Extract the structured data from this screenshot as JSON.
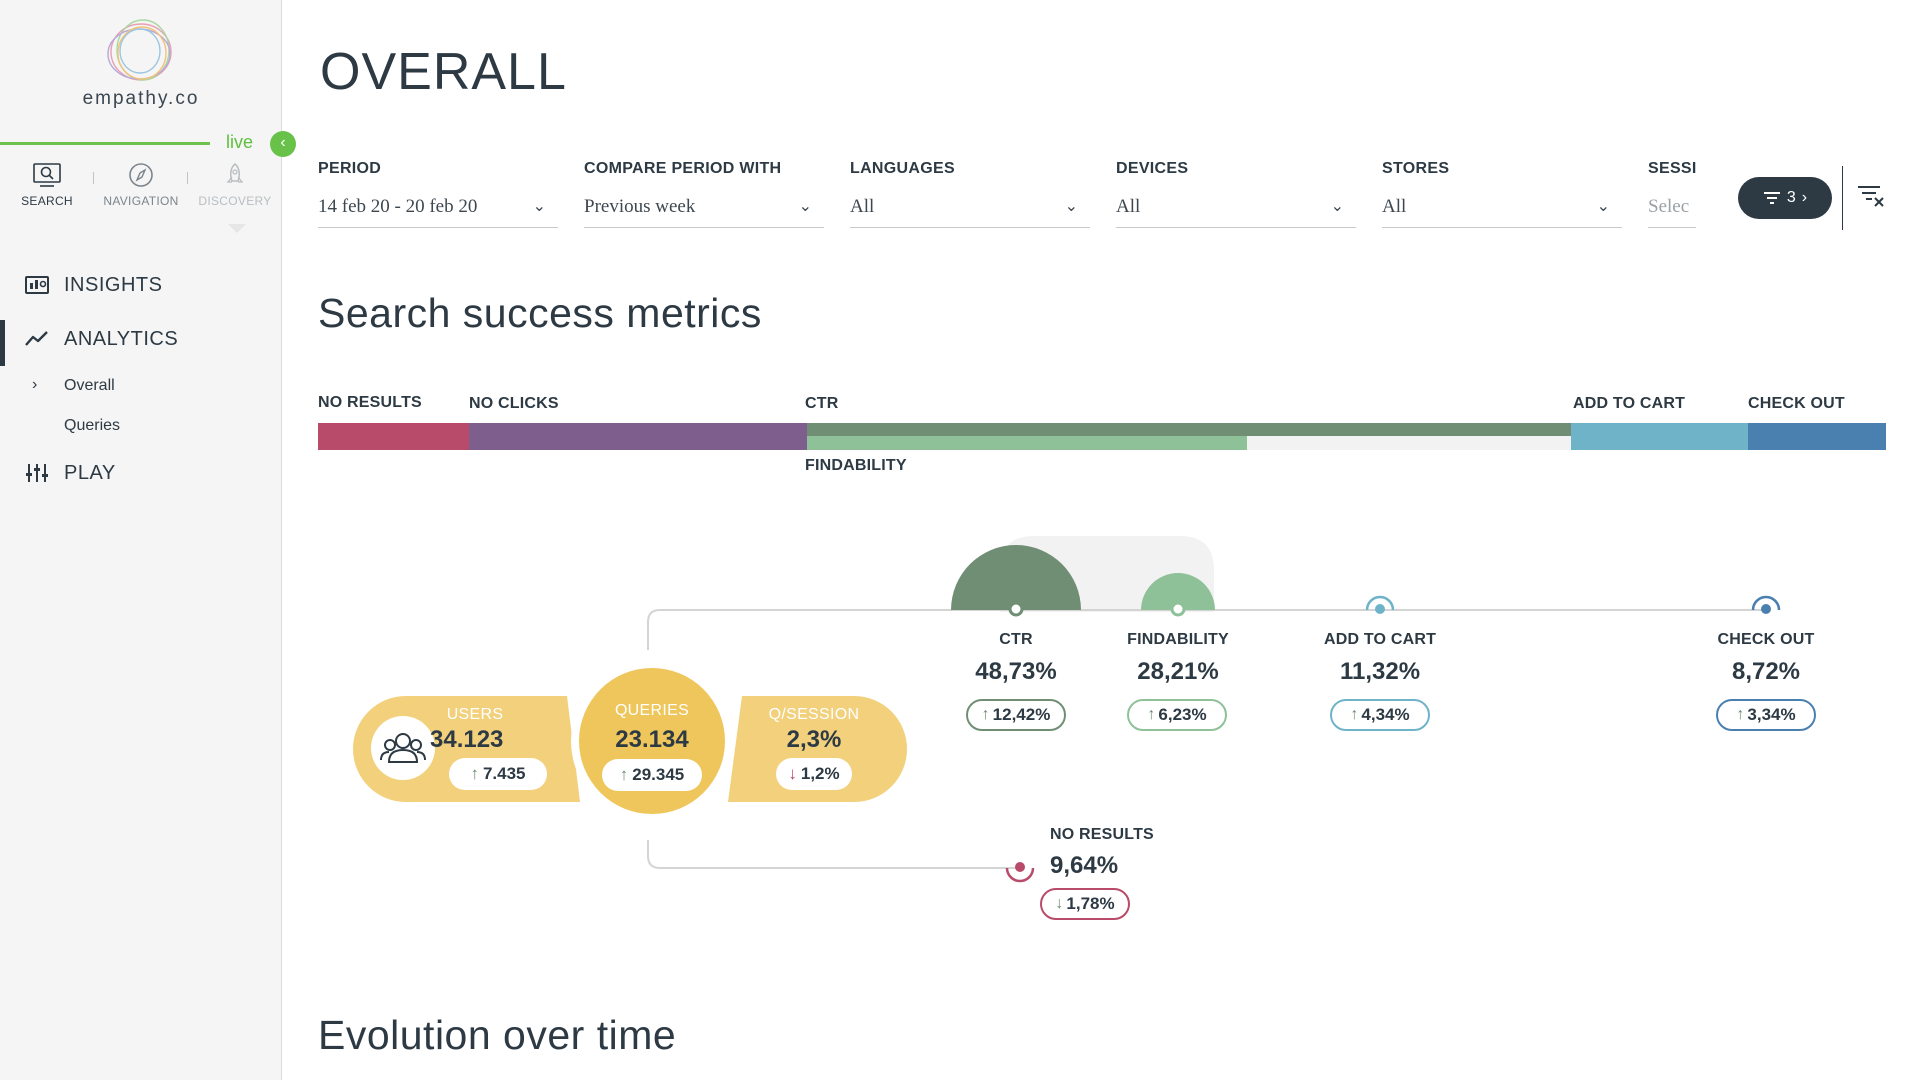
{
  "brand": {
    "name": "empathy.co",
    "live_label": "live"
  },
  "modes": [
    {
      "label": "SEARCH",
      "icon": "search-monitor-icon"
    },
    {
      "label": "NAVIGATION",
      "icon": "compass-icon"
    },
    {
      "label": "DISCOVERY",
      "icon": "rocket-icon"
    }
  ],
  "nav": {
    "insights": "INSIGHTS",
    "analytics": "ANALYTICS",
    "overall": "Overall",
    "queries": "Queries",
    "play": "PLAY"
  },
  "page": {
    "title": "OVERALL"
  },
  "filters": {
    "period": {
      "label": "PERIOD",
      "value": "14 feb 20 - 20 feb 20"
    },
    "compare": {
      "label": "COMPARE PERIOD WITH",
      "value": "Previous week"
    },
    "languages": {
      "label": "LANGUAGES",
      "value": "All"
    },
    "devices": {
      "label": "DEVICES",
      "value": "All"
    },
    "stores": {
      "label": "STORES",
      "value": "All"
    },
    "sessions": {
      "label": "SESSI",
      "placeholder": "Selec"
    },
    "active_count": "3"
  },
  "sections": {
    "metrics_title": "Search success metrics",
    "evolution_title": "Evolution over time"
  },
  "bar": {
    "no_results": "NO RESULTS",
    "no_clicks": "NO CLICKS",
    "ctr": "CTR",
    "findability": "FINDABILITY",
    "add_to_cart": "ADD TO CART",
    "check_out": "CHECK OUT"
  },
  "colors": {
    "no_results": "#b84a6a",
    "no_clicks": "#7e5e8c",
    "ctr": "#6f8e74",
    "findability": "#8fc199",
    "add_to_cart": "#6fb3c9",
    "check_out": "#4a80b0",
    "pill": "#f2d07c",
    "pill_center": "#efc65b"
  },
  "pills": {
    "users": {
      "label": "USERS",
      "value": "34.123",
      "delta": "7.435",
      "trend": "up"
    },
    "queries": {
      "label": "QUERIES",
      "value": "23.134",
      "delta": "29.345",
      "trend": "up"
    },
    "qsession": {
      "label": "Q/SESSION",
      "value": "2,3%",
      "delta": "1,2%",
      "trend": "down"
    }
  },
  "metrics": {
    "ctr": {
      "label": "CTR",
      "value": "48,73%",
      "delta": "12,42%",
      "trend": "up"
    },
    "findability": {
      "label": "FINDABILITY",
      "value": "28,21%",
      "delta": "6,23%",
      "trend": "up"
    },
    "add_to_cart": {
      "label": "ADD TO CART",
      "value": "11,32%",
      "delta": "4,34%",
      "trend": "up"
    },
    "check_out": {
      "label": "CHECK OUT",
      "value": "8,72%",
      "delta": "3,34%",
      "trend": "up"
    },
    "no_results": {
      "label": "NO RESULTS",
      "value": "9,64%",
      "delta": "1,78%",
      "trend": "down"
    }
  },
  "arrows": {
    "up": "↑",
    "down": "↓"
  }
}
